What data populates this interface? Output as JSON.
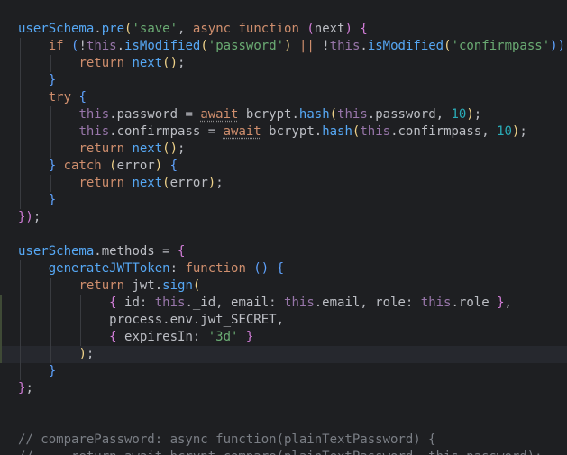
{
  "editor": {
    "language": "javascript",
    "current_line": 21,
    "lines": [
      [
        {
          "t": "})",
          "c": "br1"
        },
        {
          "t": ";",
          "c": "punct"
        }
      ],
      [],
      [
        {
          "t": "userSchema",
          "c": "fn"
        },
        {
          "t": ".",
          "c": "punct"
        },
        {
          "t": "pre",
          "c": "fn"
        },
        {
          "t": "(",
          "c": "br1"
        },
        {
          "t": "'save'",
          "c": "str"
        },
        {
          "t": ", ",
          "c": "punct"
        },
        {
          "t": "async ",
          "c": "kw"
        },
        {
          "t": "function ",
          "c": "kw"
        },
        {
          "t": "(",
          "c": "br2"
        },
        {
          "t": "next",
          "c": "ident"
        },
        {
          "t": ")",
          "c": "br2"
        },
        {
          "t": " {",
          "c": "br2"
        }
      ],
      [
        {
          "t": "    ",
          "c": "punct"
        },
        {
          "t": "if ",
          "c": "kw"
        },
        {
          "t": "(",
          "c": "br3"
        },
        {
          "t": "!",
          "c": "punct"
        },
        {
          "t": "this",
          "c": "this"
        },
        {
          "t": ".",
          "c": "punct"
        },
        {
          "t": "isModified",
          "c": "fn"
        },
        {
          "t": "(",
          "c": "br1"
        },
        {
          "t": "'password'",
          "c": "str"
        },
        {
          "t": ")",
          "c": "br1"
        },
        {
          "t": " || ",
          "c": "kw"
        },
        {
          "t": "!",
          "c": "punct"
        },
        {
          "t": "this",
          "c": "this"
        },
        {
          "t": ".",
          "c": "punct"
        },
        {
          "t": "isModified",
          "c": "fn"
        },
        {
          "t": "(",
          "c": "br1"
        },
        {
          "t": "'confirmpass'",
          "c": "str"
        },
        {
          "t": "))",
          "c": "br3"
        }
      ],
      [
        {
          "t": "        ",
          "c": "punct"
        },
        {
          "t": "return ",
          "c": "kw"
        },
        {
          "t": "next",
          "c": "fn"
        },
        {
          "t": "()",
          "c": "br1"
        },
        {
          "t": ";",
          "c": "punct"
        }
      ],
      [
        {
          "t": "    ",
          "c": "punct"
        },
        {
          "t": "}",
          "c": "br3"
        }
      ],
      [
        {
          "t": "    ",
          "c": "punct"
        },
        {
          "t": "try ",
          "c": "kw"
        },
        {
          "t": "{",
          "c": "br3"
        }
      ],
      [
        {
          "t": "        ",
          "c": "punct"
        },
        {
          "t": "this",
          "c": "this"
        },
        {
          "t": ".password = ",
          "c": "prop"
        },
        {
          "t": "await",
          "c": "kw dotted"
        },
        {
          "t": " bcrypt.",
          "c": "ident"
        },
        {
          "t": "hash",
          "c": "fn"
        },
        {
          "t": "(",
          "c": "br1"
        },
        {
          "t": "this",
          "c": "this"
        },
        {
          "t": ".password, ",
          "c": "prop"
        },
        {
          "t": "10",
          "c": "num"
        },
        {
          "t": ")",
          "c": "br1"
        },
        {
          "t": ";",
          "c": "punct"
        }
      ],
      [
        {
          "t": "        ",
          "c": "punct"
        },
        {
          "t": "this",
          "c": "this"
        },
        {
          "t": ".confirmpass = ",
          "c": "prop"
        },
        {
          "t": "await",
          "c": "kw dotted"
        },
        {
          "t": " bcrypt.",
          "c": "ident"
        },
        {
          "t": "hash",
          "c": "fn"
        },
        {
          "t": "(",
          "c": "br1"
        },
        {
          "t": "this",
          "c": "this"
        },
        {
          "t": ".confirmpass, ",
          "c": "prop"
        },
        {
          "t": "10",
          "c": "num"
        },
        {
          "t": ")",
          "c": "br1"
        },
        {
          "t": ";",
          "c": "punct"
        }
      ],
      [
        {
          "t": "        ",
          "c": "punct"
        },
        {
          "t": "return ",
          "c": "kw"
        },
        {
          "t": "next",
          "c": "fn"
        },
        {
          "t": "()",
          "c": "br1"
        },
        {
          "t": ";",
          "c": "punct"
        }
      ],
      [
        {
          "t": "    ",
          "c": "punct"
        },
        {
          "t": "} ",
          "c": "br3"
        },
        {
          "t": "catch ",
          "c": "kw"
        },
        {
          "t": "(",
          "c": "br1"
        },
        {
          "t": "error",
          "c": "ident"
        },
        {
          "t": ")",
          "c": "br1"
        },
        {
          "t": " {",
          "c": "br3"
        }
      ],
      [
        {
          "t": "        ",
          "c": "punct"
        },
        {
          "t": "return ",
          "c": "kw"
        },
        {
          "t": "next",
          "c": "fn"
        },
        {
          "t": "(",
          "c": "br1"
        },
        {
          "t": "error",
          "c": "ident"
        },
        {
          "t": ")",
          "c": "br1"
        },
        {
          "t": ";",
          "c": "punct"
        }
      ],
      [
        {
          "t": "    ",
          "c": "punct"
        },
        {
          "t": "}",
          "c": "br3"
        }
      ],
      [
        {
          "t": "})",
          "c": "br2"
        },
        {
          "t": ";",
          "c": "punct"
        }
      ],
      [],
      [
        {
          "t": "userSchema",
          "c": "fn"
        },
        {
          "t": ".methods = ",
          "c": "prop"
        },
        {
          "t": "{",
          "c": "br2"
        }
      ],
      [
        {
          "t": "    ",
          "c": "punct"
        },
        {
          "t": "generateJWTToken",
          "c": "fn"
        },
        {
          "t": ": ",
          "c": "punct"
        },
        {
          "t": "function ",
          "c": "kw"
        },
        {
          "t": "() ",
          "c": "br3"
        },
        {
          "t": "{",
          "c": "br3"
        }
      ],
      [
        {
          "t": "        ",
          "c": "punct"
        },
        {
          "t": "return ",
          "c": "kw"
        },
        {
          "t": "jwt.",
          "c": "ident"
        },
        {
          "t": "sign",
          "c": "fn"
        },
        {
          "t": "(",
          "c": "br1"
        }
      ],
      [
        {
          "t": "            ",
          "c": "punct"
        },
        {
          "t": "{ ",
          "c": "br2"
        },
        {
          "t": "id: ",
          "c": "prop"
        },
        {
          "t": "this",
          "c": "this"
        },
        {
          "t": "._id, email: ",
          "c": "prop"
        },
        {
          "t": "this",
          "c": "this"
        },
        {
          "t": ".email, role: ",
          "c": "prop"
        },
        {
          "t": "this",
          "c": "this"
        },
        {
          "t": ".role ",
          "c": "prop"
        },
        {
          "t": "}",
          "c": "br2"
        },
        {
          "t": ",",
          "c": "punct"
        }
      ],
      [
        {
          "t": "            ",
          "c": "punct"
        },
        {
          "t": "process.env.jwt_SECRET,",
          "c": "ident"
        }
      ],
      [
        {
          "t": "            ",
          "c": "punct"
        },
        {
          "t": "{ ",
          "c": "br2"
        },
        {
          "t": "expiresIn: ",
          "c": "prop"
        },
        {
          "t": "'3d'",
          "c": "str"
        },
        {
          "t": " }",
          "c": "br2"
        }
      ],
      [
        {
          "t": "        ",
          "c": "punct"
        },
        {
          "t": ")",
          "c": "br1"
        },
        {
          "t": ";",
          "c": "punct"
        }
      ],
      [
        {
          "t": "    ",
          "c": "punct"
        },
        {
          "t": "}",
          "c": "br3"
        }
      ],
      [
        {
          "t": "}",
          "c": "br2"
        },
        {
          "t": ";",
          "c": "punct"
        }
      ],
      [],
      [],
      [
        {
          "t": "// comparePassword: async function(plainTextPassword) {",
          "c": "cmt"
        }
      ],
      [
        {
          "t": "//     return await bcrypt.compare(plainTextPassword, this.password);",
          "c": "cmt"
        }
      ]
    ]
  }
}
